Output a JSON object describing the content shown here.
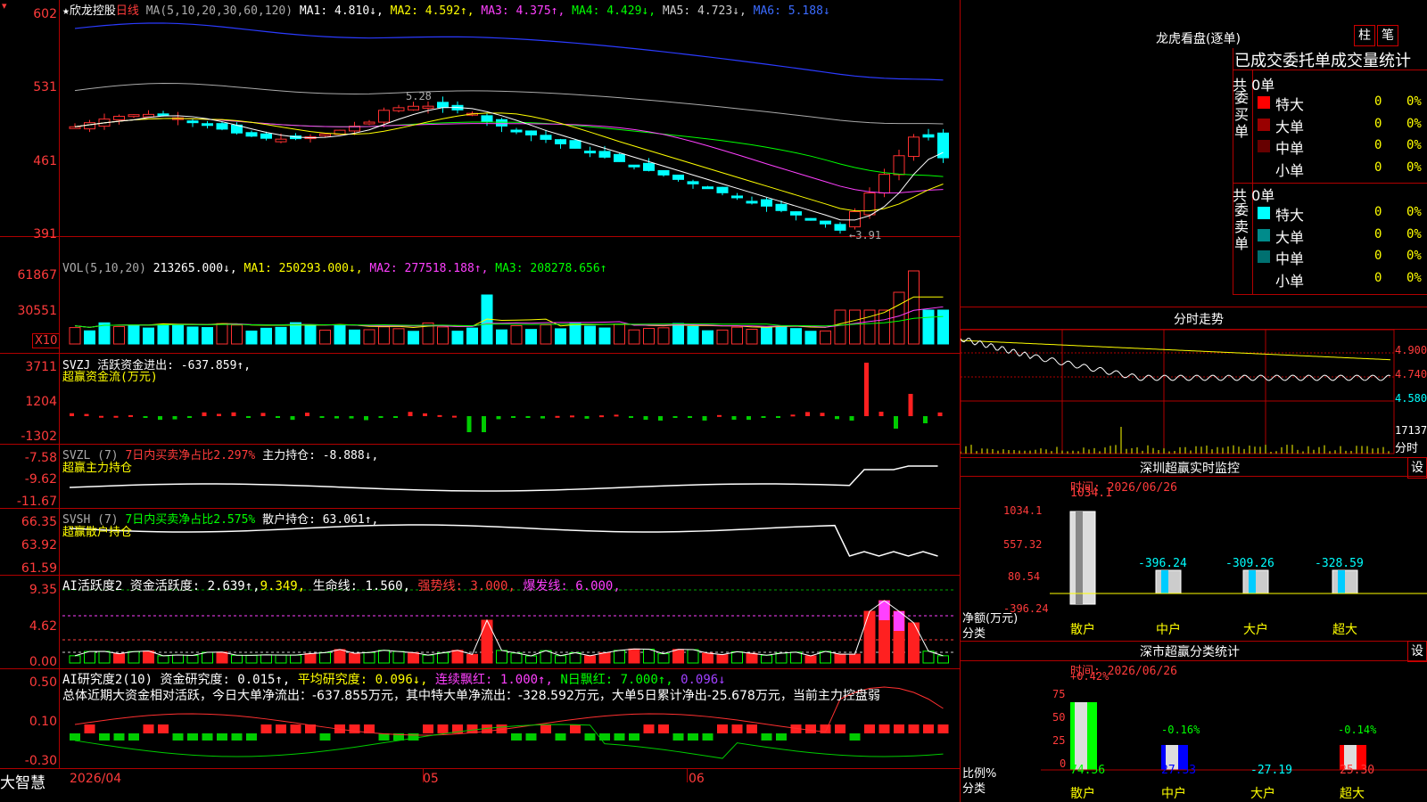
{
  "stock": {
    "name": "欣龙控股",
    "period": "日线",
    "ma_title": "MA(5,10,20,30,60,120)",
    "ma": [
      {
        "label": "MA1:",
        "value": "4.810↓,",
        "color": "#ffffff"
      },
      {
        "label": "MA2:",
        "value": "4.592↑,",
        "color": "#ffff00"
      },
      {
        "label": "MA3:",
        "value": "4.375↑,",
        "color": "#ff40ff"
      },
      {
        "label": "MA4:",
        "value": "4.429↓,",
        "color": "#00ff00"
      },
      {
        "label": "MA5:",
        "value": "4.723↓,",
        "color": "#cccccc"
      },
      {
        "label": "MA6:",
        "value": "5.188↓",
        "color": "#3b6bff"
      }
    ],
    "yticks": [
      "602",
      "531",
      "461",
      "391"
    ],
    "high_mark": "5.28",
    "low_mark": "←3.91"
  },
  "vol": {
    "legend": "VOL(5,10,20)",
    "val": "213265.000↓,",
    "ma1": "MA1: 250293.000↓,",
    "ma2": "MA2: 277518.188↑,",
    "ma3": "MA3: 208278.656↑",
    "yticks": [
      "61867",
      "30551"
    ],
    "unit": "X10"
  },
  "svzj": {
    "legend": "SVZJ  活跃资金进出: -637.859↑,",
    "sub": "超赢资金流(万元)",
    "yticks": [
      "3711",
      "1204",
      "-1302"
    ]
  },
  "svzl": {
    "legend_a": "SVZL (7)",
    "legend_b": "7日内买卖净占比2.297%",
    "legend_c": "主力持仓: -8.888↓,",
    "sub": "超赢主力持仓",
    "yticks": [
      "-7.58",
      "-9.62",
      "-11.67"
    ]
  },
  "svsh": {
    "legend_a": "SVSH (7)",
    "legend_b": "7日内买卖净占比2.575%",
    "legend_c": "散户持仓: 63.061↑,",
    "sub": "超赢散户持仓",
    "yticks": [
      "66.35",
      "63.92",
      "61.59"
    ]
  },
  "ai1": {
    "a": "AI活跃度2",
    "b": "资金活跃度: 2.639↑,",
    "c": "9.349,",
    "d": "生命线: 1.560,",
    "e": "强势线: 3.000,",
    "f": "爆发线: 6.000,",
    "yticks": [
      "9.35",
      "4.62",
      "0.00"
    ]
  },
  "ai2": {
    "a": "AI研究度2(10)",
    "b": "资金研究度: 0.015↑,",
    "c": "平均研究度: 0.096↓,",
    "d": "连续飘红: 1.000↑,",
    "e": "N日飘红: 7.000↑,",
    "f": "0.096↓",
    "summary": "总体近期大资金相对活跃，今日大单净流出：-637.855万元，其中特大单净流出：-328.592万元，大单5日累计净出-25.678万元，当前主力控盘弱",
    "yticks": [
      "0.50",
      "0.10",
      "-0.30"
    ]
  },
  "xaxis": {
    "labels": [
      "2026/04",
      "05",
      "06"
    ]
  },
  "brand": "大智慧",
  "right": {
    "lh_title": "龙虎看盘(逐单)",
    "btn1": "柱",
    "btn2": "笔",
    "tab_title": "已成交委托单成交量统计",
    "buy": {
      "side": "委买单",
      "total": "共 0单",
      "rows": [
        {
          "n": "特大",
          "v": "0",
          "p": "0%",
          "c": "#ff0000"
        },
        {
          "n": "大单",
          "v": "0",
          "p": "0%",
          "c": "#990000"
        },
        {
          "n": "中单",
          "v": "0",
          "p": "0%",
          "c": "#660000"
        },
        {
          "n": "小单",
          "v": "0",
          "p": "0%",
          "c": ""
        }
      ]
    },
    "sell": {
      "side": "委卖单",
      "total": "共 0单",
      "rows": [
        {
          "n": "特大",
          "v": "0",
          "p": "0%",
          "c": "#00ffff"
        },
        {
          "n": "大单",
          "v": "0",
          "p": "0%",
          "c": "#008b8b"
        },
        {
          "n": "中单",
          "v": "0",
          "p": "0%",
          "c": "#007070"
        },
        {
          "n": "小单",
          "v": "0",
          "p": "0%",
          "c": ""
        }
      ]
    },
    "fs_title": "分时走势",
    "fs_yticks": [
      "4.900",
      "4.740",
      "4.580",
      "17137"
    ],
    "fs_unit": "分时",
    "sz_title": "深圳超赢实时监控",
    "sz_time": "时间: 2026/06/26",
    "sz_set": "设",
    "sz_yticks": [
      "1034.1",
      "557.32",
      "80.54",
      "-396.24"
    ],
    "sz_vals": [
      "1034.1",
      "-396.24",
      "-309.26",
      "-328.59"
    ],
    "sz_ylabel": "净额(万元)",
    "sz_xlabel": "分类",
    "sz_cats": [
      "散户",
      "中户",
      "大户",
      "超大"
    ],
    "fl_title": "深市超赢分类统计",
    "fl_time": "时间: 2026/06/26",
    "fl_set": "设",
    "fl_yticks": [
      "75",
      "50",
      "25",
      "0"
    ],
    "fl_tops": [
      "+0.42%",
      "-0.16%",
      "-0.14%"
    ],
    "fl_bottom": [
      "74.56",
      "27.33",
      "-27.19",
      "25.30"
    ],
    "fl_ylabel": "比例%",
    "fl_xlabel": "分类",
    "fl_cats": [
      "散户",
      "中户",
      "大户",
      "超大"
    ]
  }
}
